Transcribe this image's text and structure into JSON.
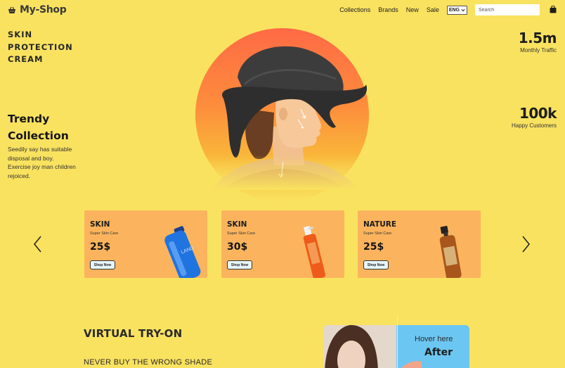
{
  "header": {
    "logo_text": "My-Shop",
    "nav": [
      "Collections",
      "Brands",
      "New",
      "Sale"
    ],
    "language": "ENG",
    "search_placeholder": "Search"
  },
  "hero": {
    "kicker_lines": [
      "SKIN",
      "PROTECTION",
      "CREAM"
    ],
    "title_lines": [
      "Trendy",
      "Collection"
    ],
    "description_lines": [
      "Seedily say has suitable",
      "disposal and boy.",
      "Exercise joy man children",
      "rejoiced."
    ]
  },
  "stats": [
    {
      "value": "1.5m",
      "label": "Monthly Traffic"
    },
    {
      "value": "100k",
      "label": "Happy Customers"
    }
  ],
  "products": [
    {
      "title": "SKIN",
      "subtitle": "Super Skin Care",
      "price": "25$",
      "button": "Shop Now",
      "bottle_label": "LAND"
    },
    {
      "title": "SKIN",
      "subtitle": "Super Skin Care",
      "price": "30$",
      "button": "Shop Now"
    },
    {
      "title": "NATURE",
      "subtitle": "Super Skin Care",
      "price": "25$",
      "button": "Shop Now"
    }
  ],
  "virtual_try_on": {
    "title": "VIRTUAL TRY-ON",
    "subtitle": "NEVER BUY THE WRONG SHADE",
    "hover_text": "Hover here",
    "after_label": "After"
  },
  "colors": {
    "background": "#f9e25f",
    "card": "#fbb45d",
    "accent_circle": "#ff6a45",
    "vto_panel": "#6cc6f2"
  },
  "icons": [
    "basket-icon",
    "chevron-down-icon",
    "shopping-bag-icon",
    "chevron-left-icon",
    "chevron-right-icon"
  ]
}
